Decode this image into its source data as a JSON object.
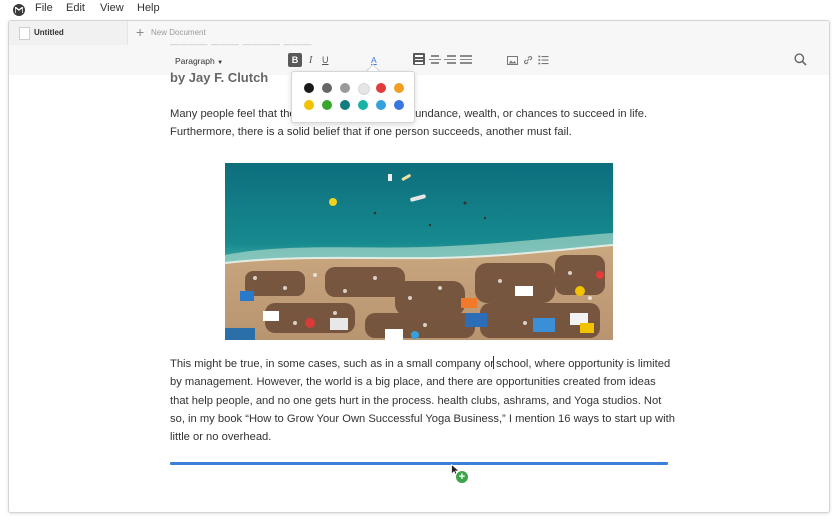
{
  "menubar": {
    "items": [
      "File",
      "Edit",
      "View",
      "Help"
    ]
  },
  "tabs": {
    "active_label": "Untitled",
    "new_label": "New Document"
  },
  "toolbar": {
    "paragraph_label": "Paragraph",
    "bold_label": "B",
    "italic_label": "I",
    "underline_label": "U",
    "text_color_label": "A"
  },
  "color_palette": {
    "row1": [
      "#1a1a1a",
      "#666666",
      "#9a9a9a",
      "#e6e6e6",
      "#e23b3b",
      "#f0a020"
    ],
    "row2": [
      "#f2c200",
      "#3aa52c",
      "#137c7c",
      "#19b3a3",
      "#35a3db",
      "#3a76e0"
    ]
  },
  "document": {
    "byline": "by Jay F. Clutch",
    "paragraph1_left": "Many people feel that the",
    "paragraph1_right": "abundance, wealth, or chances to succeed in life.",
    "paragraph1_line2": "Furthermore, there is a solid belief that if one person succeeds, another must fail.",
    "paragraph2_before_cursor": "This might be true, in some cases, such as in a small company or",
    "paragraph2_after_cursor": " school, where opportunity is limited by management. However, the world is a big place, and there are opportunities created from ideas that help people, and no one gets hurt in the process.  health clubs, ashrams, and Yoga studios. Not so, in my book “How to Grow Your Own Successful Yoga Business,” I mention 16 ways to start up with little or no overhead."
  }
}
